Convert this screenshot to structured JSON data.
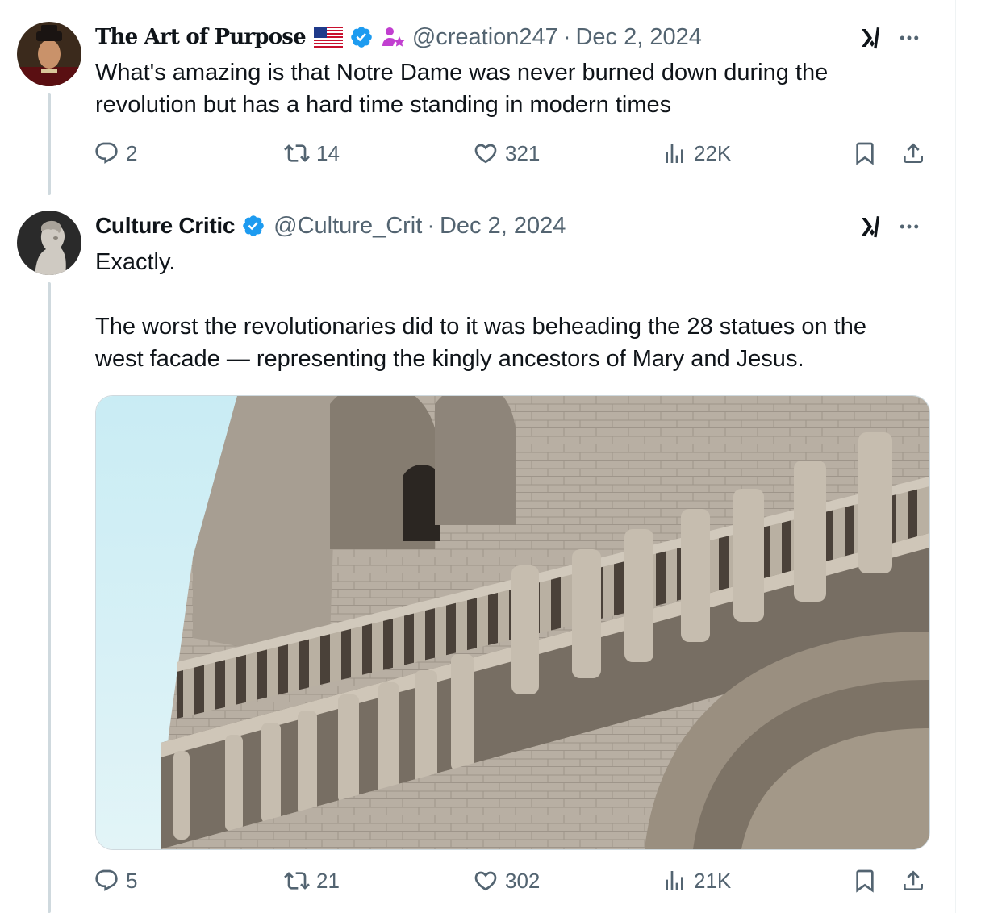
{
  "tweets": [
    {
      "display_name": "The Art of Purpose",
      "handle": "@creation247",
      "date": "Dec 2, 2024",
      "separator": "·",
      "text": "What's amazing is that Notre Dame was never burned down during the\nrevolution but has a hard time standing in modern times",
      "badges": [
        "us-flag-icon",
        "verified-badge-icon",
        "person-star-icon"
      ],
      "stats": {
        "replies": "2",
        "reposts": "14",
        "likes": "321",
        "views": "22K"
      }
    },
    {
      "display_name": "Culture Critic",
      "handle": "@Culture_Crit",
      "date": "Dec 2, 2024",
      "separator": "·",
      "text": "Exactly.\n\nThe worst the revolutionaries did to it was beheading the 28 statues on the\nwest facade — representing the kingly ancestors of Mary and Jesus.",
      "badges": [
        "verified-badge-icon"
      ],
      "media": "notre-dame-west-facade-gallery-of-kings-photo",
      "stats": {
        "replies": "5",
        "reposts": "21",
        "likes": "302",
        "views": "21K"
      }
    }
  ],
  "colors": {
    "verified": "#1d9bf0",
    "secondary_text": "#536471",
    "thread_line": "#cfd9de",
    "person_badge": "#c13fd0"
  }
}
